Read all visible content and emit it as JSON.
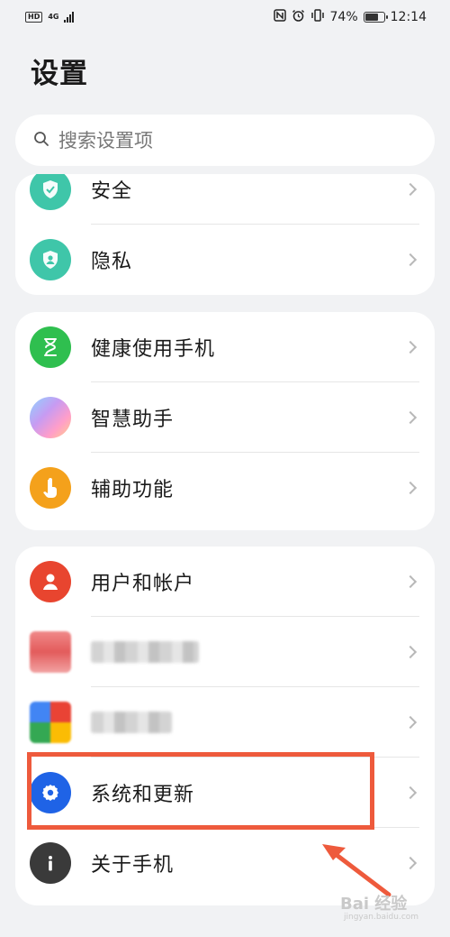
{
  "status_bar": {
    "left_badge": "HD",
    "network": "4G",
    "battery_pct": "74%",
    "battery_level": 0.74,
    "time": "12:14",
    "icons": [
      "nfc-icon",
      "alarm-icon",
      "vibrate-icon",
      "battery-icon"
    ]
  },
  "page": {
    "title": "设置"
  },
  "search": {
    "placeholder": "搜索设置项"
  },
  "groups": [
    {
      "items": [
        {
          "label": "安全",
          "icon": "shield-icon",
          "color": "#3fc6a9"
        },
        {
          "label": "隐私",
          "icon": "privacy-icon",
          "color": "#3fc6a9"
        }
      ]
    },
    {
      "items": [
        {
          "label": "健康使用手机",
          "icon": "hourglass-icon",
          "color": "#2fbf4f"
        },
        {
          "label": "智慧助手",
          "icon": "assistant-orb-icon",
          "color": "#b69af0"
        },
        {
          "label": "辅助功能",
          "icon": "hand-pointer-icon",
          "color": "#f4a11b"
        }
      ]
    },
    {
      "items": [
        {
          "label": "用户和帐户",
          "icon": "user-icon",
          "color": "#e8452f"
        },
        {
          "label": "",
          "icon": "blurred-app-icon",
          "color": "#e35c5c",
          "blurred": true
        },
        {
          "label": "",
          "icon": "blurred-app-icon",
          "color": "#4caf50",
          "blurred": true
        },
        {
          "label": "系统和更新",
          "icon": "gear-icon",
          "color": "#1f63e6",
          "highlighted": true
        },
        {
          "label": "关于手机",
          "icon": "info-icon",
          "color": "#3a3a3a"
        }
      ]
    }
  ],
  "annotation": {
    "highlight_color": "#ee5a3c"
  },
  "watermark": {
    "text": "Bai 经验",
    "sub": "jingyan.baidu.com"
  }
}
